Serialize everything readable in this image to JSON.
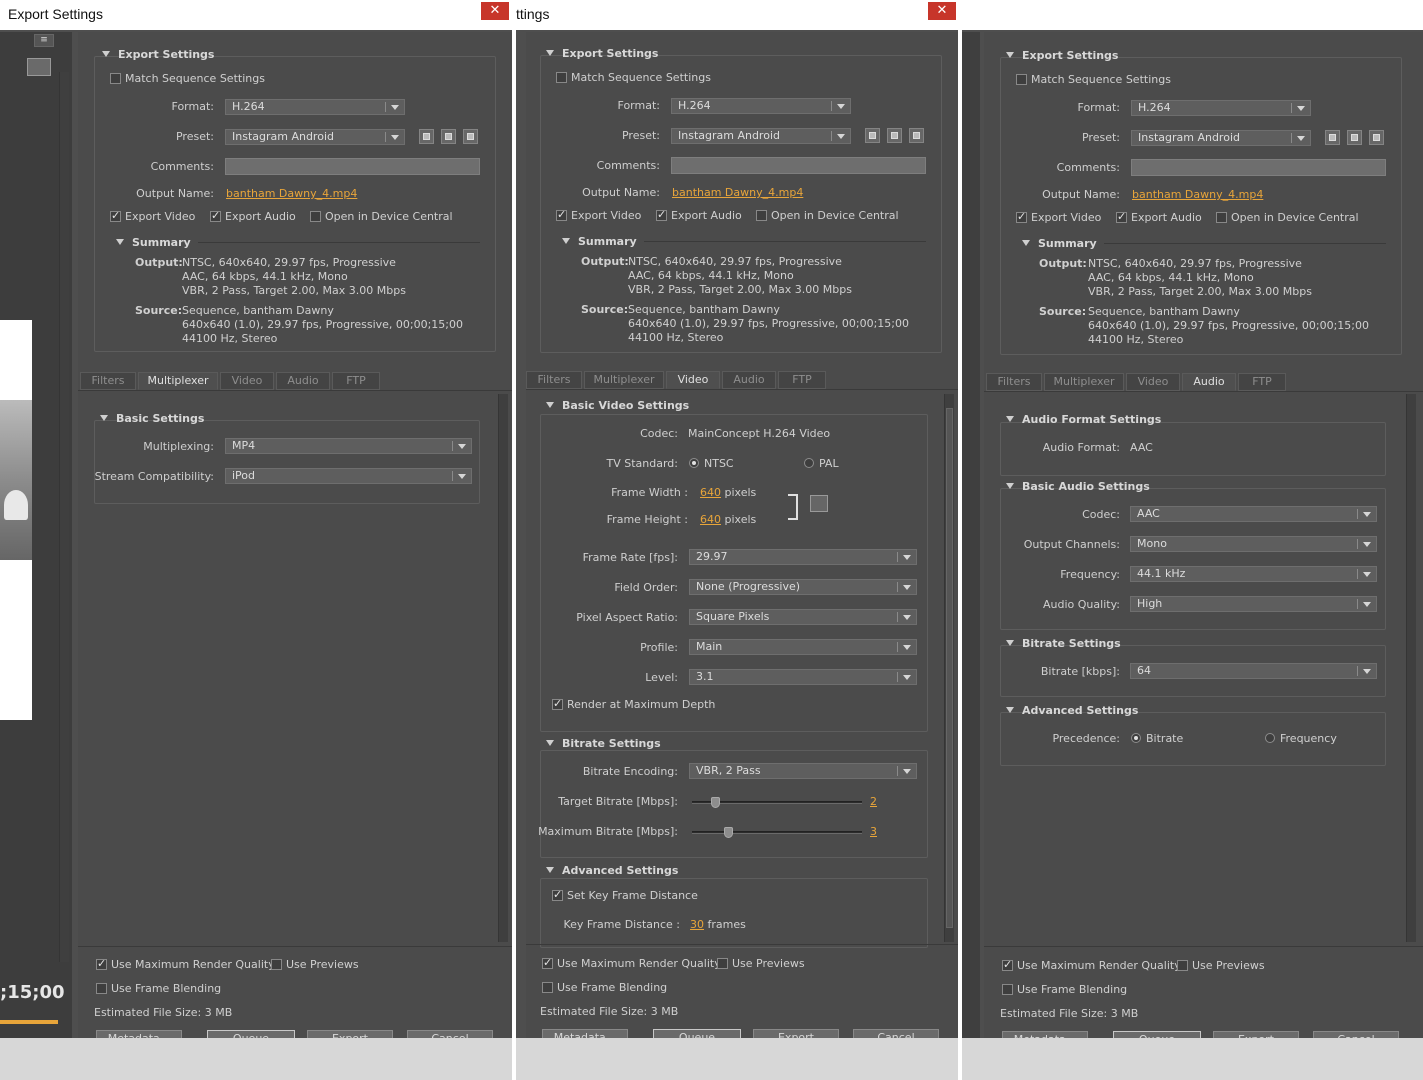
{
  "window_title": "Export Settings",
  "window_title_partial": "ttings",
  "close_glyph": "✕",
  "preview_timecode": ";15;00",
  "export_settings": {
    "section_title": "Export Settings",
    "match_sequence": "Match Sequence Settings",
    "format_label": "Format:",
    "format_value": "H.264",
    "preset_label": "Preset:",
    "preset_value": "Instagram Android",
    "comments_label": "Comments:",
    "output_name_label": "Output Name:",
    "output_name_value": "bantham Dawny_4.mp4",
    "export_video": "Export Video",
    "export_audio": "Export Audio",
    "open_device_central": "Open in Device Central"
  },
  "summary": {
    "title": "Summary",
    "output_label": "Output:",
    "output_lines": [
      "NTSC, 640x640, 29.97 fps, Progressive",
      "AAC, 64 kbps, 44.1 kHz, Mono",
      "VBR, 2 Pass, Target 2.00, Max 3.00 Mbps"
    ],
    "source_label": "Source:",
    "source_lines": [
      "Sequence, bantham Dawny",
      "640x640 (1.0), 29.97 fps, Progressive, 00;00;15;00",
      "44100 Hz, Stereo"
    ]
  },
  "tabs": [
    "Filters",
    "Multiplexer",
    "Video",
    "Audio",
    "FTP"
  ],
  "multiplexer": {
    "section": "Basic Settings",
    "multiplexing_label": "Multiplexing:",
    "multiplexing_value": "MP4",
    "stream_label": "Stream Compatibility:",
    "stream_value": "iPod"
  },
  "video": {
    "basic_section": "Basic Video Settings",
    "codec_label": "Codec:",
    "codec_value": "MainConcept H.264 Video",
    "tv_label": "TV Standard:",
    "tv_ntsc": "NTSC",
    "tv_pal": "PAL",
    "width_label": "Frame Width :",
    "width_value": "640",
    "height_label": "Frame Height :",
    "height_value": "640",
    "pixels": "pixels",
    "framerate_label": "Frame Rate [fps]:",
    "framerate_value": "29.97",
    "field_label": "Field Order:",
    "field_value": "None (Progressive)",
    "par_label": "Pixel Aspect Ratio:",
    "par_value": "Square Pixels",
    "profile_label": "Profile:",
    "profile_value": "Main",
    "level_label": "Level:",
    "level_value": "3.1",
    "max_depth": "Render at Maximum Depth",
    "bitrate_section": "Bitrate Settings",
    "encoding_label": "Bitrate Encoding:",
    "encoding_value": "VBR, 2 Pass",
    "target_label": "Target Bitrate [Mbps]:",
    "target_value": "2",
    "target_fraction": 0.12,
    "max_label": "Maximum Bitrate [Mbps]:",
    "max_value": "3",
    "max_fraction": 0.2,
    "advanced_section": "Advanced Settings",
    "keyframe_check": "Set Key Frame Distance",
    "keyframe_label": "Key Frame Distance :",
    "keyframe_value": "30",
    "frames": "frames"
  },
  "audio": {
    "format_section": "Audio Format Settings",
    "format_label": "Audio Format:",
    "format_value": "AAC",
    "basic_section": "Basic Audio Settings",
    "codec_label": "Codec:",
    "codec_value": "AAC",
    "channels_label": "Output Channels:",
    "channels_value": "Mono",
    "frequency_label": "Frequency:",
    "frequency_value": "44.1 kHz",
    "quality_label": "Audio Quality:",
    "quality_value": "High",
    "bitrate_section": "Bitrate Settings",
    "bitrate_label": "Bitrate [kbps]:",
    "bitrate_value": "64",
    "advanced_section": "Advanced Settings",
    "precedence_label": "Precedence:",
    "prec_bitrate": "Bitrate",
    "prec_frequency": "Frequency"
  },
  "footer": {
    "max_render_quality": "Use Maximum Render Quality",
    "use_previews": "Use Previews",
    "frame_blending": "Use Frame Blending",
    "file_size": "Estimated File Size:  3 MB",
    "metadata": "Metadata...",
    "queue": "Queue",
    "export": "Export",
    "cancel": "Cancel"
  }
}
